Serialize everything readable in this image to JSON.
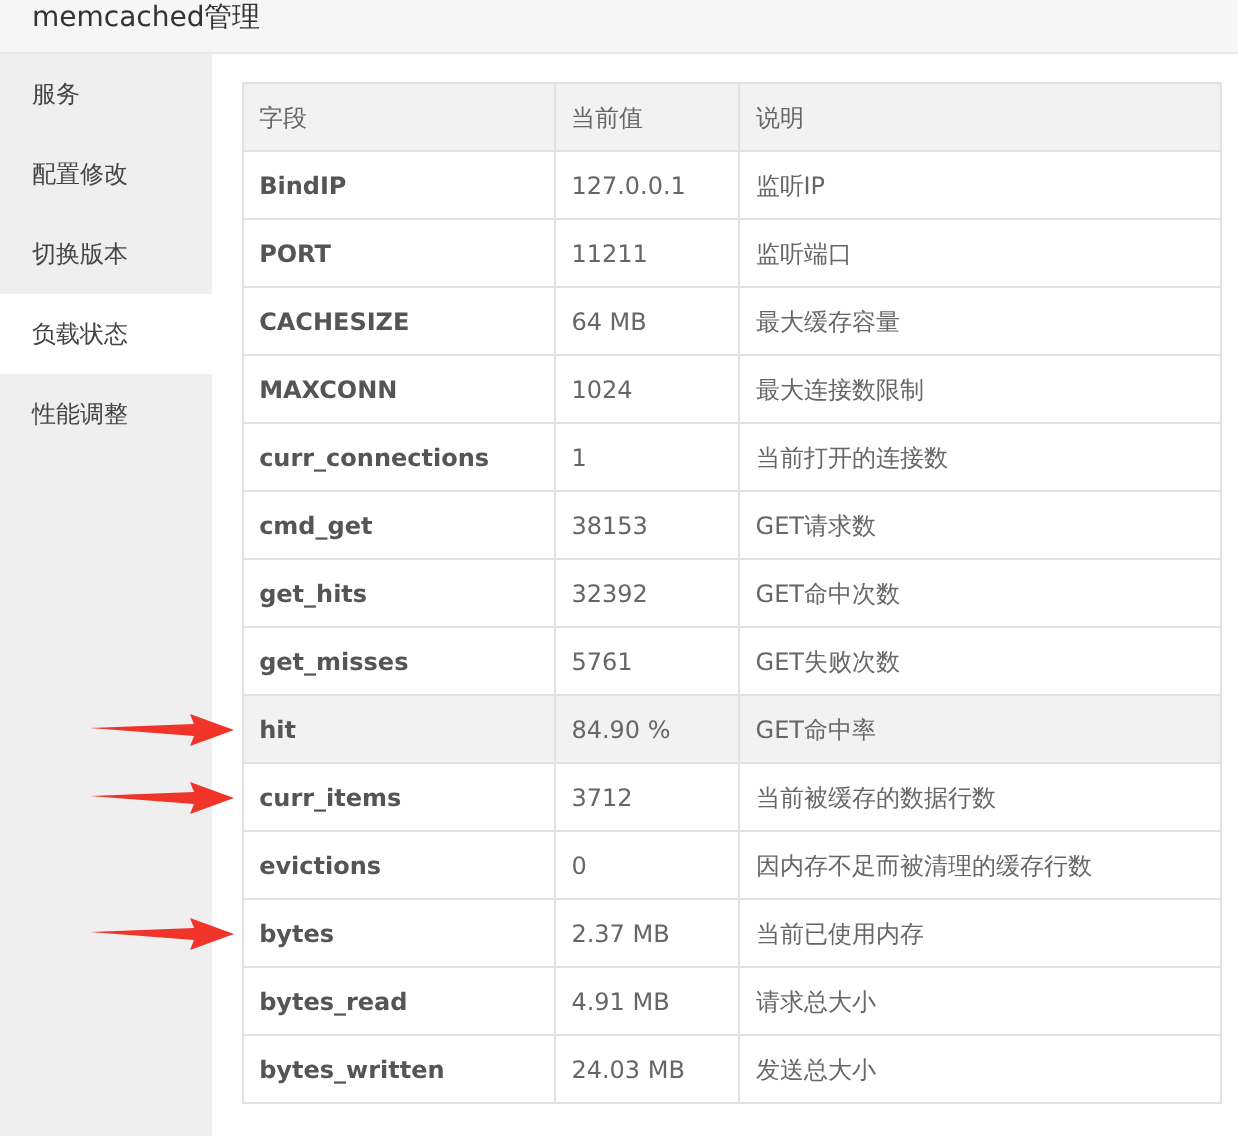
{
  "header": {
    "title": "memcached管理"
  },
  "sidebar": {
    "items": [
      {
        "label": "服务",
        "selected": false
      },
      {
        "label": "配置修改",
        "selected": false
      },
      {
        "label": "切换版本",
        "selected": false
      },
      {
        "label": "负载状态",
        "selected": true
      },
      {
        "label": "性能调整",
        "selected": false
      }
    ]
  },
  "table": {
    "columns": [
      "字段",
      "当前值",
      "说明"
    ],
    "rows": [
      {
        "cells": [
          "BindIP",
          "127.0.0.1",
          "监听IP"
        ],
        "highlighted": false,
        "marked": false
      },
      {
        "cells": [
          "PORT",
          "11211",
          "监听端口"
        ],
        "highlighted": false,
        "marked": false
      },
      {
        "cells": [
          "CACHESIZE",
          "64 MB",
          "最大缓存容量"
        ],
        "highlighted": false,
        "marked": false
      },
      {
        "cells": [
          "MAXCONN",
          "1024",
          "最大连接数限制"
        ],
        "highlighted": false,
        "marked": false
      },
      {
        "cells": [
          "curr_connections",
          "1",
          "当前打开的连接数"
        ],
        "highlighted": false,
        "marked": false
      },
      {
        "cells": [
          "cmd_get",
          "38153",
          "GET请求数"
        ],
        "highlighted": false,
        "marked": false
      },
      {
        "cells": [
          "get_hits",
          "32392",
          "GET命中次数"
        ],
        "highlighted": false,
        "marked": false
      },
      {
        "cells": [
          "get_misses",
          "5761",
          "GET失败次数"
        ],
        "highlighted": false,
        "marked": false
      },
      {
        "cells": [
          "hit",
          "84.90 %",
          "GET命中率"
        ],
        "highlighted": true,
        "marked": true
      },
      {
        "cells": [
          "curr_items",
          "3712",
          "当前被缓存的数据行数"
        ],
        "highlighted": false,
        "marked": true
      },
      {
        "cells": [
          "evictions",
          "0",
          "因内存不足而被清理的缓存行数"
        ],
        "highlighted": false,
        "marked": false
      },
      {
        "cells": [
          "bytes",
          "2.37 MB",
          "当前已使用内存"
        ],
        "highlighted": false,
        "marked": true
      },
      {
        "cells": [
          "bytes_read",
          "4.91 MB",
          "请求总大小"
        ],
        "highlighted": false,
        "marked": false
      },
      {
        "cells": [
          "bytes_written",
          "24.03 MB",
          "发送总大小"
        ],
        "highlighted": false,
        "marked": false
      }
    ]
  }
}
